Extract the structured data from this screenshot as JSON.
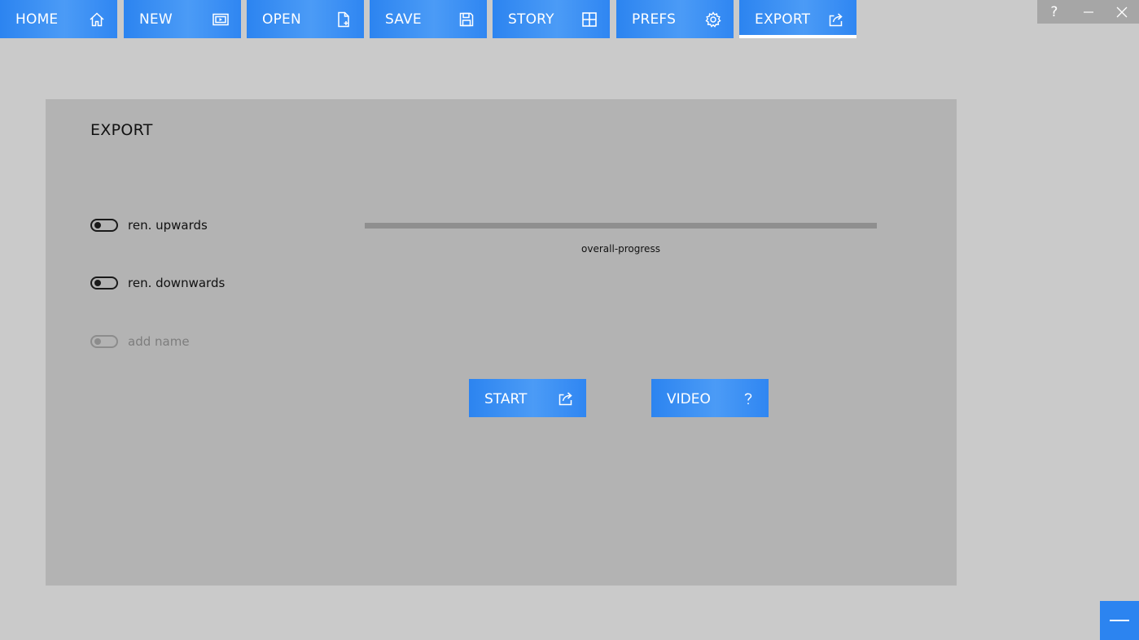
{
  "nav": {
    "items": [
      {
        "label": "HOME",
        "icon": "home-icon"
      },
      {
        "label": "NEW",
        "icon": "new-slide-icon"
      },
      {
        "label": "OPEN",
        "icon": "open-file-icon"
      },
      {
        "label": "SAVE",
        "icon": "save-icon"
      },
      {
        "label": "STORY",
        "icon": "grid-icon"
      },
      {
        "label": "PREFS",
        "icon": "gear-icon"
      },
      {
        "label": "EXPORT",
        "icon": "share-icon",
        "active": true
      }
    ]
  },
  "window_controls": {
    "help": "?",
    "minimize_icon": "minimize-icon",
    "close_icon": "close-icon"
  },
  "panel": {
    "title": "EXPORT",
    "toggles": [
      {
        "label": "ren. upwards",
        "on": false,
        "enabled": true
      },
      {
        "label": "ren. downwards",
        "on": false,
        "enabled": true
      },
      {
        "label": "add name",
        "on": false,
        "enabled": false
      }
    ],
    "progress": {
      "caption": "overall-progress",
      "value": 0
    },
    "start_button": {
      "label": "START",
      "icon": "share-icon"
    },
    "video_button": {
      "label": "VIDEO",
      "icon": "question-icon"
    }
  },
  "corner_button": {
    "icon": "minus-icon"
  },
  "colors": {
    "accent": "#2c84f0",
    "background": "#cacaca",
    "panel": "#b3b3b3"
  }
}
